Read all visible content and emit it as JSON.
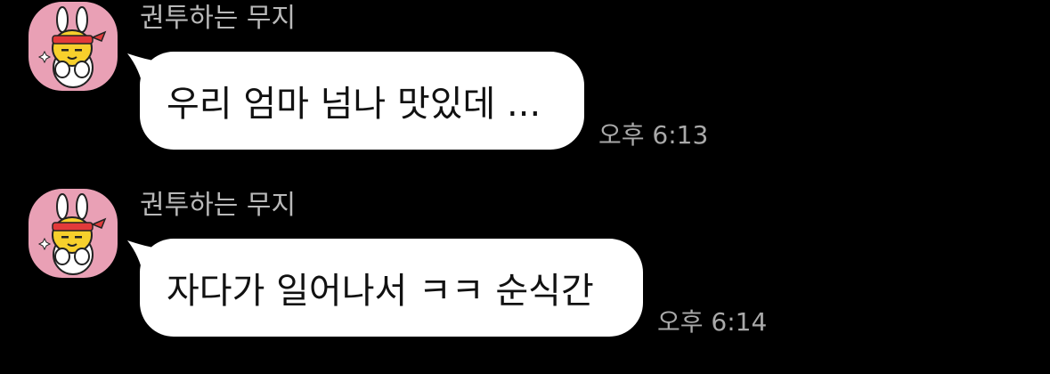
{
  "colors": {
    "background": "#000000",
    "bubble": "#ffffff",
    "avatar_bg": "#e9a0b5",
    "sender_text": "#b9b9b9",
    "time_text": "#a9a9a9"
  },
  "messages": [
    {
      "sender": "권투하는 무지",
      "avatar_icon": "muzi-boxing-avatar-icon",
      "text": "우리 엄마 넘나 맛있데 ...",
      "time": "오후 6:13"
    },
    {
      "sender": "권투하는 무지",
      "avatar_icon": "muzi-boxing-avatar-icon",
      "text": "자다가 일어나서 ㅋㅋ 순식간",
      "time": "오후 6:14"
    }
  ]
}
